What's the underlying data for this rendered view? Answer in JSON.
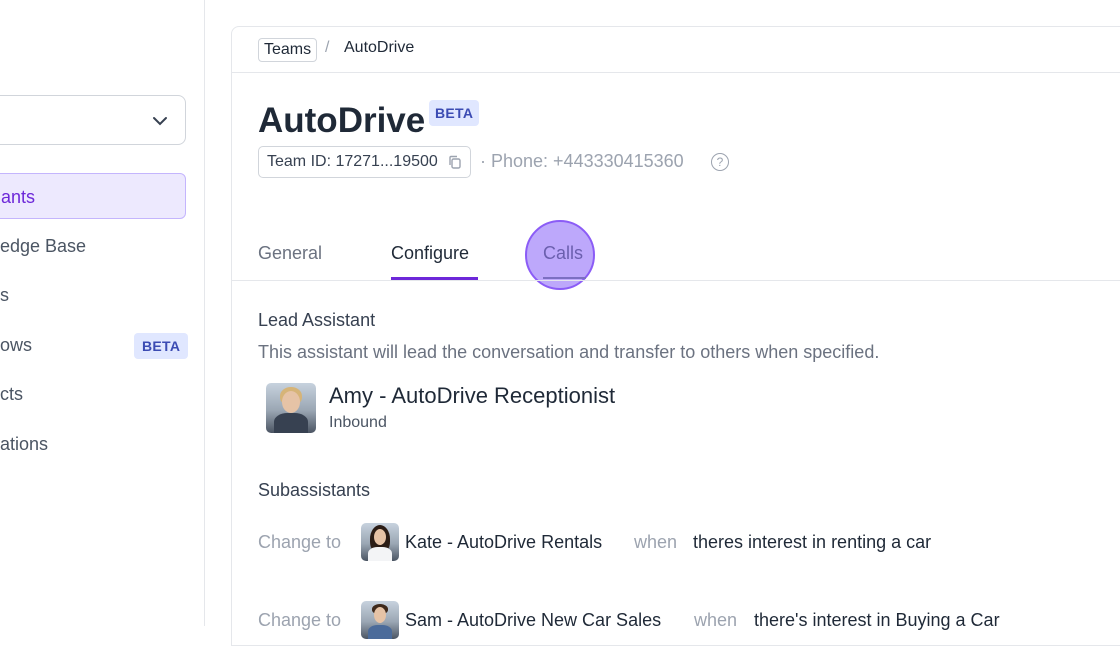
{
  "sidebar": {
    "items": [
      {
        "label": "ants",
        "active": true
      },
      {
        "label": "edge Base"
      },
      {
        "label": "s"
      },
      {
        "label": "ows",
        "badge": "BETA"
      },
      {
        "label": "cts"
      },
      {
        "label": "ations"
      }
    ]
  },
  "breadcrumb": {
    "root": "Teams",
    "separator": "/",
    "current": "AutoDrive"
  },
  "header": {
    "title": "AutoDrive",
    "badge": "BETA",
    "team_id": "Team ID: 17271...19500",
    "phone": "· Phone: +443330415360",
    "help_glyph": "?"
  },
  "tabs": [
    {
      "label": "General"
    },
    {
      "label": "Configure",
      "active": true
    },
    {
      "label": "Calls"
    }
  ],
  "lead": {
    "heading": "Lead Assistant",
    "description": "This assistant will lead the conversation and transfer to others when specified.",
    "name": "Amy - AutoDrive Receptionist",
    "direction": "Inbound"
  },
  "subassistants": {
    "heading": "Subassistants",
    "rows": [
      {
        "prefix": "Change to",
        "name": "Kate - AutoDrive Rentals",
        "when": "when",
        "condition": "theres interest in renting a car"
      },
      {
        "prefix": "Change to",
        "name": "Sam - AutoDrive New Car Sales",
        "when": "when",
        "condition": "there's interest in Buying a Car"
      }
    ]
  },
  "colors": {
    "accent": "#6d28d9",
    "badge_bg": "#e0e7ff",
    "highlight": "#a78bfa"
  }
}
